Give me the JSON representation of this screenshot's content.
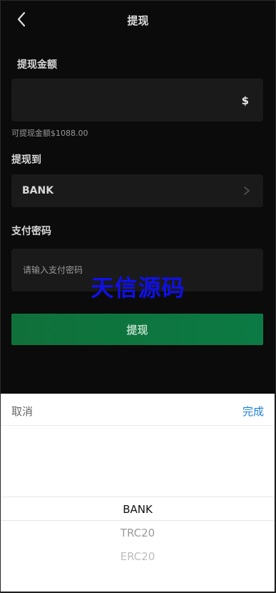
{
  "header": {
    "title": "提现",
    "back_icon": "chevron-left-icon"
  },
  "amount": {
    "label": "提现金额",
    "value": "",
    "currency_symbol": "$",
    "available_hint": "可提现金额$1088.00"
  },
  "destination": {
    "label": "提现到",
    "value": "BANK",
    "icon": "chevron-right-icon"
  },
  "password": {
    "label": "支付密码",
    "placeholder": "请输入支付密码"
  },
  "watermark": "天信源码",
  "submit_label": "提现",
  "picker": {
    "cancel_label": "取消",
    "done_label": "完成",
    "options": [
      "BANK",
      "TRC20",
      "ERC20"
    ],
    "selected": "BANK"
  },
  "colors": {
    "accent_green": "#0c7a44",
    "picker_done": "#1c7ed6",
    "watermark": "#1010e8"
  }
}
